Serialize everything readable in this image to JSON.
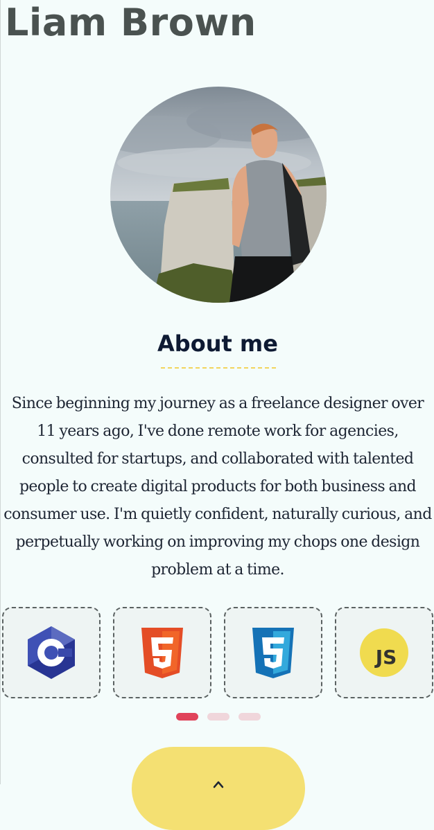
{
  "header": {
    "name": "Liam Brown"
  },
  "profile": {
    "photo_alt": "Portrait of Liam Brown on a cliff by the sea"
  },
  "about": {
    "heading": "About me",
    "body": "Since beginning my journey as a freelance designer over 11 years ago, I've done remote work for agencies, consulted for startups, and collaborated with talented people to create digital products for both business and consumer use. I'm quietly confident, naturally curious, and perpetually working on improving my chops one design problem at a time."
  },
  "skills": {
    "items": [
      {
        "icon": "c-language-icon",
        "label": "C"
      },
      {
        "icon": "html5-icon",
        "label": "5"
      },
      {
        "icon": "css3-icon",
        "label": "3"
      },
      {
        "icon": "javascript-icon",
        "label": "JS"
      }
    ]
  },
  "carousel": {
    "active_index": 0,
    "page_count": 3
  },
  "colors": {
    "background": "#f4fcfb",
    "title": "#4a5250",
    "heading": "#0e1a33",
    "accent_yellow": "#f4e072",
    "dot_active": "#e0435a",
    "dot_inactive": "#f0d6db",
    "card_border": "#5b6262"
  },
  "cta": {
    "icon": "chevron-up-icon"
  }
}
